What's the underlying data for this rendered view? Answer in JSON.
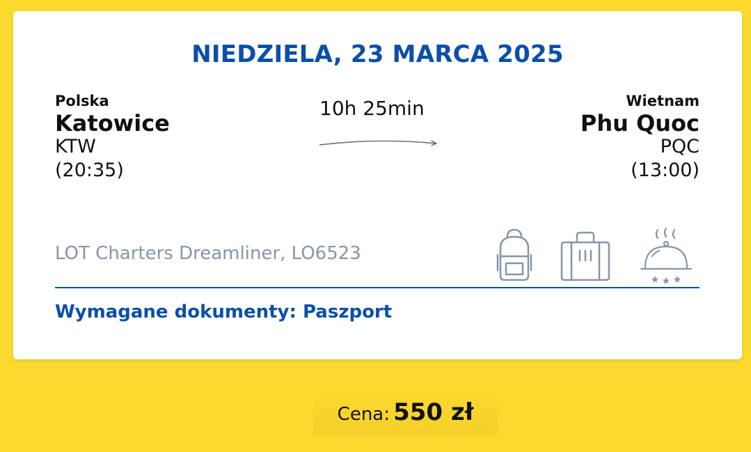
{
  "flight": {
    "date_heading": "NIEDZIELA, 23 MARCA 2025",
    "origin": {
      "country": "Polska",
      "city": "Katowice",
      "code": "KTW",
      "time": "(20:35)"
    },
    "destination": {
      "country": "Wietnam",
      "city": "Phu Quoc",
      "code": "PQC",
      "time": "(13:00)"
    },
    "duration": "10h 25min",
    "aircraft": "LOT Charters Dreamliner, LO6523",
    "documents": "Wymagane dokumenty: Paszport",
    "amenity_icons": [
      "backpack-icon",
      "suitcase-icon",
      "meal-cloche-icon"
    ]
  },
  "price": {
    "label": "Cena:",
    "value": "550 zł"
  },
  "colors": {
    "background": "#FCD92F",
    "accent_blue": "#0B4FA8",
    "muted_gray": "#8496A8",
    "text": "#111111"
  }
}
